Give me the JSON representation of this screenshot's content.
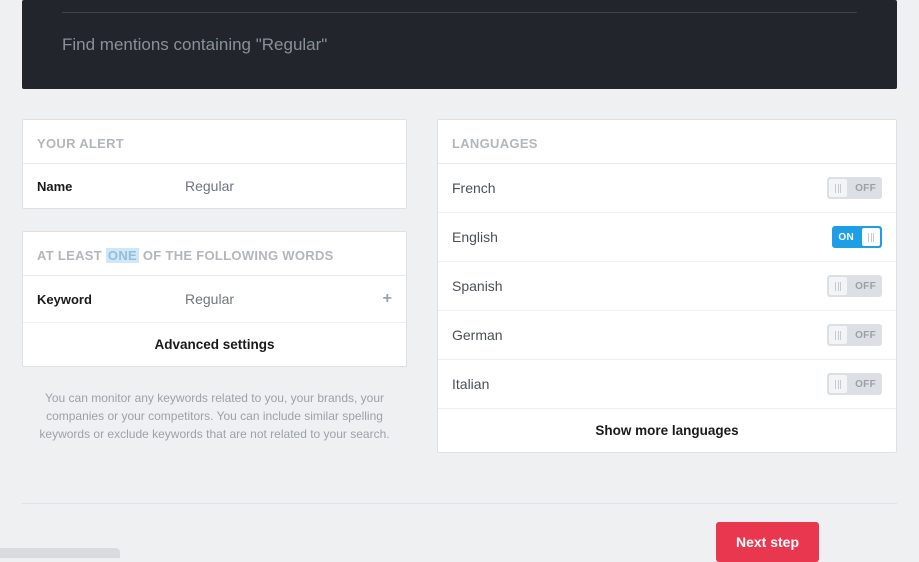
{
  "dark": {
    "find_line": "Find mentions containing \"Regular\""
  },
  "alert": {
    "header": "YOUR ALERT",
    "name_label": "Name",
    "name_value": "Regular"
  },
  "words": {
    "header_pre": "AT LEAST ",
    "header_hl": "ONE",
    "header_post": " OF THE FOLLOWING WORDS",
    "keyword_label": "Keyword",
    "keyword_value": "Regular",
    "advanced": "Advanced settings"
  },
  "help": "You can monitor any keywords related to you, your brands, your companies or your competitors. You can include similar spelling keywords or exclude keywords that are not related to your search.",
  "languages": {
    "header": "LANGUAGES",
    "items": [
      {
        "label": "French",
        "on": false
      },
      {
        "label": "English",
        "on": true
      },
      {
        "label": "Spanish",
        "on": false
      },
      {
        "label": "German",
        "on": false
      },
      {
        "label": "Italian",
        "on": false
      }
    ],
    "show_more": "Show more languages",
    "on_text": "ON",
    "off_text": "OFF"
  },
  "footer": {
    "next": "Next step"
  }
}
